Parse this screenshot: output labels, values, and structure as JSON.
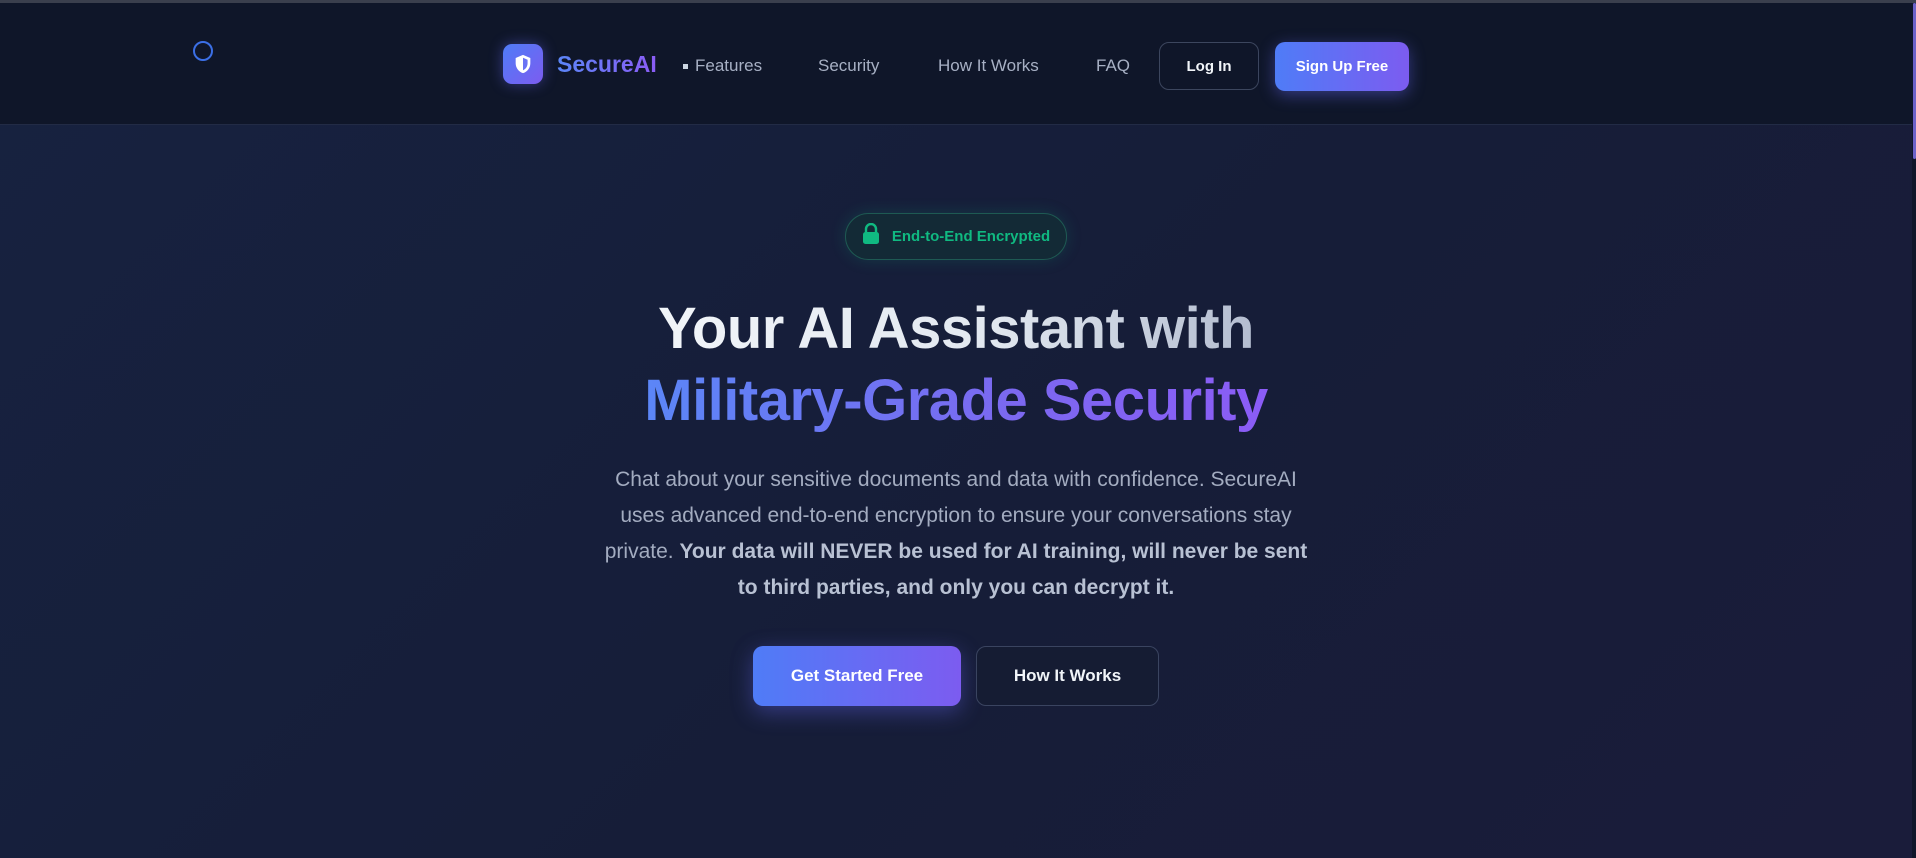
{
  "header": {
    "brand_name": "SecureAI",
    "nav": [
      {
        "label": "Features"
      },
      {
        "label": "Security"
      },
      {
        "label": "How It Works"
      },
      {
        "label": "FAQ"
      }
    ],
    "login_label": "Log In",
    "signup_label": "Sign Up Free"
  },
  "hero": {
    "badge_label": "End-to-End Encrypted",
    "title_line1": "Your AI Assistant with",
    "title_line2": "Military-Grade Security",
    "description": "Chat about your sensitive documents and data with confidence. SecureAI uses advanced end-to-end encryption to ensure your conversations stay private.",
    "description_bold": "Your data will NEVER be used for AI training, will never be sent to third parties, and only you can decrypt it.",
    "primary_cta": "Get Started Free",
    "secondary_cta": "How It Works"
  },
  "icons": {
    "logo": "shield-icon",
    "badge": "lock-icon",
    "loading": "loading-ring-icon"
  },
  "colors": {
    "background": "#141b33",
    "header_bg": "#0f1629",
    "accent_blue": "#4f7cf7",
    "accent_purple": "#7c5cf0",
    "success_green": "#10b981",
    "muted_text": "#a3acc0"
  }
}
